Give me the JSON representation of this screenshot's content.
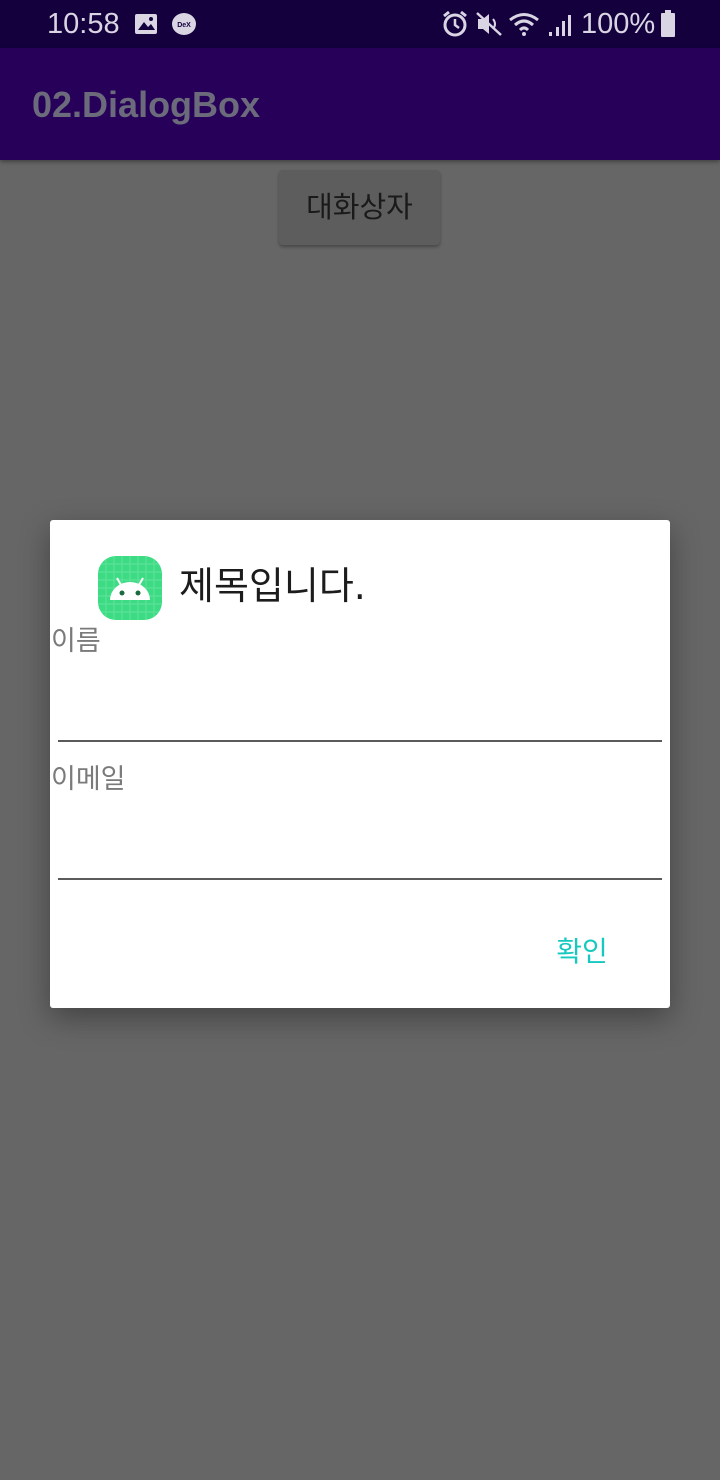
{
  "status_bar": {
    "time": "10:58",
    "battery": "100%",
    "icons": [
      "image-icon",
      "dex-icon",
      "alarm-icon",
      "mute-icon",
      "wifi-icon",
      "signal-icon",
      "battery-icon"
    ]
  },
  "app_bar": {
    "title": "02.DialogBox"
  },
  "main": {
    "button_label": "대화상자"
  },
  "dialog": {
    "title": "제목입니다.",
    "icon": "android-app-icon",
    "fields": [
      {
        "label": "이름",
        "value": ""
      },
      {
        "label": "이메일",
        "value": ""
      }
    ],
    "confirm_label": "확인"
  },
  "colors": {
    "status_bar": "#13003d",
    "app_bar": "#270059",
    "scrim_background": "#666666",
    "accent": "#16c9c0",
    "icon_green": "#3ddc84"
  }
}
